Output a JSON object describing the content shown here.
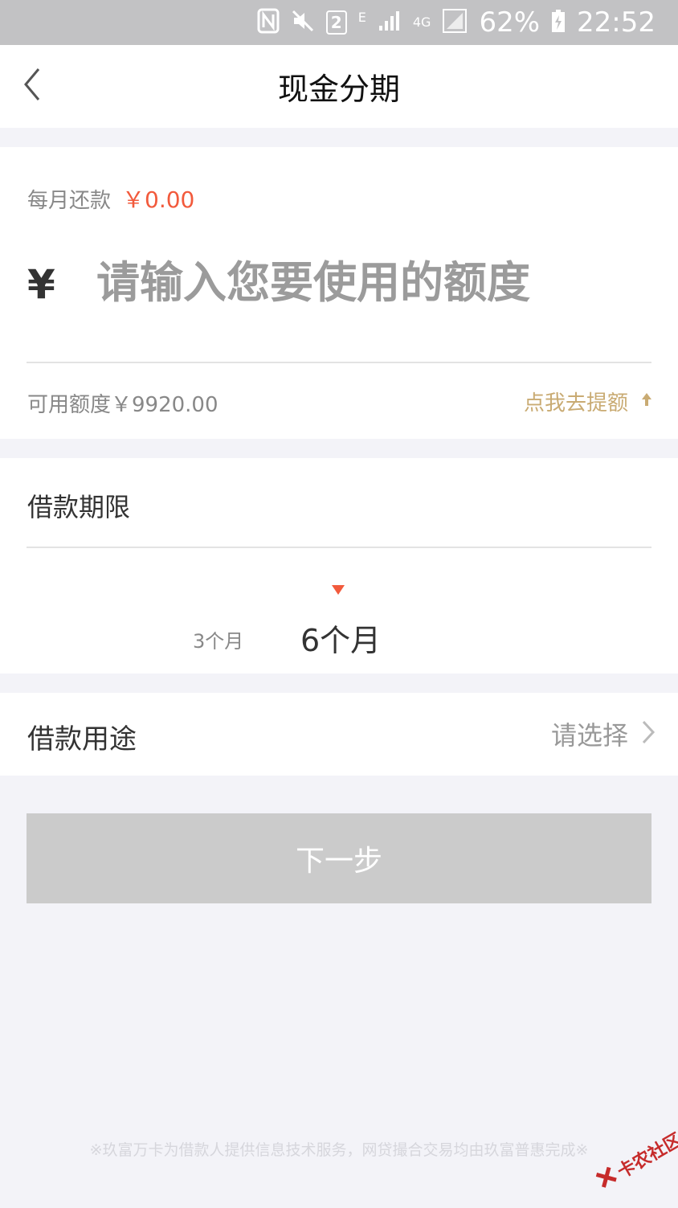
{
  "status_bar": {
    "network_e": "E",
    "network_4g": "4G",
    "sim_badge": "2",
    "battery": "62%",
    "time": "22:52"
  },
  "nav": {
    "title": "现金分期"
  },
  "repayment": {
    "monthly_label": "每月还款",
    "monthly_value": "￥0.00",
    "currency_symbol": "¥",
    "amount_placeholder": "请输入您要使用的额度",
    "available_credit": "可用额度￥9920.00",
    "raise_link": "点我去提额"
  },
  "term": {
    "label": "借款期限",
    "options": [
      "3个月",
      "6个月"
    ],
    "selected": "6个月"
  },
  "purpose": {
    "label": "借款用途",
    "value": "请选择"
  },
  "actions": {
    "next_label": "下一步"
  },
  "footer": {
    "disclaimer": "※玖富万卡为借款人提供信息技术服务，网贷撮合交易均由玖富普惠完成※",
    "watermark": "卡农社区"
  },
  "colors": {
    "accent_red": "#f25a3c",
    "gold": "#c9ab73",
    "button_disabled": "#cbcbcb",
    "background": "#f3f3f8"
  }
}
